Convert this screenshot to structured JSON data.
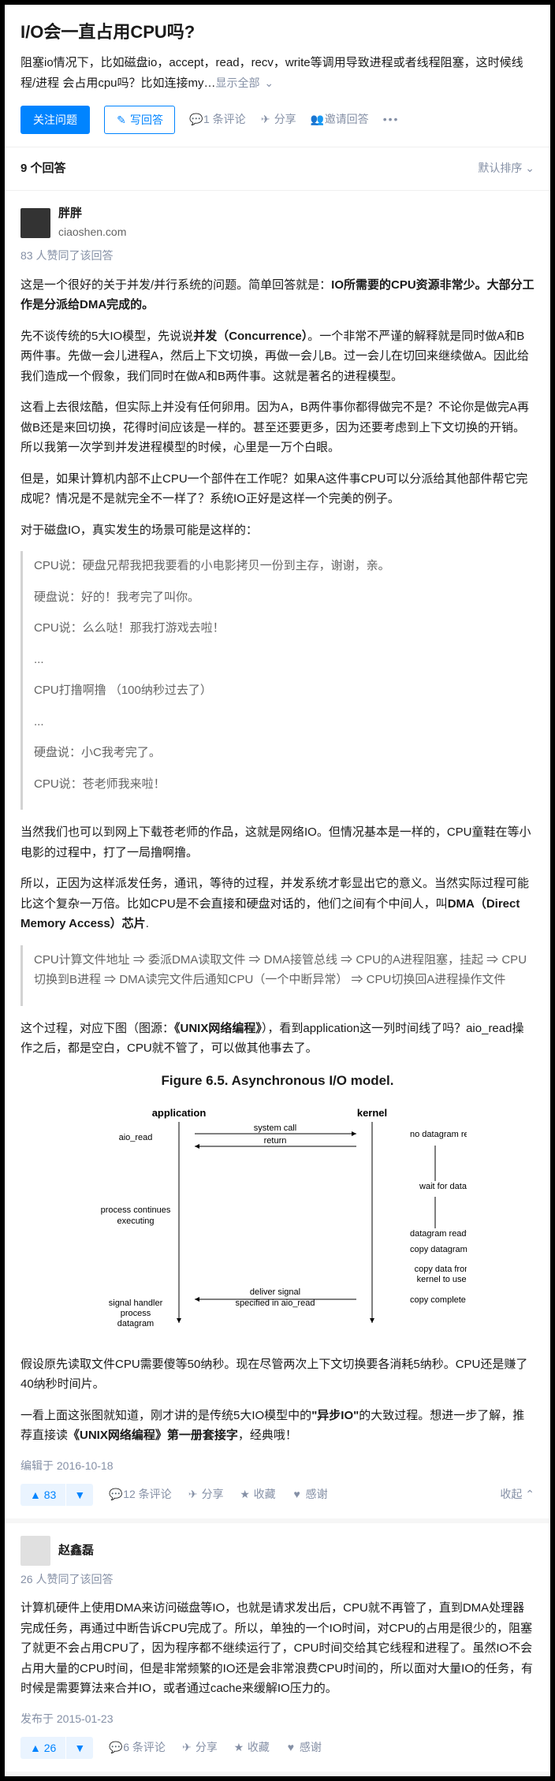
{
  "question": {
    "title": "I/O会一直占用CPU吗?",
    "body": "阻塞io情况下，比如磁盘io，accept，read，recv，write等调用导致进程或者线程阻塞，这时候线程/进程 会占用cpu吗？比如连接my…",
    "show_all": "显示全部",
    "follow": "关注问题",
    "write": "写回答",
    "comments": "1 条评论",
    "share": "分享",
    "invite": "邀请回答"
  },
  "answers_header": {
    "count": "9 个回答",
    "sort": "默认排序"
  },
  "answer1": {
    "author": {
      "name": "胖胖",
      "bio": "ciaoshen.com"
    },
    "upvotes_line": "83 人赞同了该回答",
    "p1a": "这是一个很好的关于并发/并行系统的问题。简单回答就是：",
    "p1b": "IO所需要的CPU资源非常少。大部分工作是分派给DMA完成的。",
    "p2a": "先不谈传统的5大IO模型，先说说",
    "p2b": "并发（Concurrence）",
    "p2c": "。一个非常不严谨的解释就是同时做A和B两件事。先做一会儿进程A，然后上下文切换，再做一会儿B。过一会儿在切回来继续做A。因此给我们造成一个假象，我们同时在做A和B两件事。这就是著名的进程模型。",
    "p3": "这看上去很炫酷，但实际上并没有任何卵用。因为A，B两件事你都得做完不是？不论你是做完A再做B还是来回切换，花得时间应该是一样的。甚至还要更多，因为还要考虑到上下文切换的开销。所以我第一次学到并发进程模型的时候，心里是一万个白眼。",
    "p4": "但是，如果计算机内部不止CPU一个部件在工作呢？如果A这件事CPU可以分派给其他部件帮它完成呢？情况是不是就完全不一样了？系统IO正好是这样一个完美的例子。",
    "p5": "对于磁盘IO，真实发生的场景可能是这样的：",
    "quote1": {
      "l1": "CPU说：硬盘兄帮我把我要看的小电影拷贝一份到主存，谢谢，亲。",
      "l2": "硬盘说：好的！我考完了叫你。",
      "l3": "CPU说：么么哒！那我打游戏去啦！",
      "l4": "...",
      "l5": "CPU打撸啊撸 （100纳秒过去了）",
      "l6": "...",
      "l7": "硬盘说：小C我考完了。",
      "l8": "CPU说：苍老师我来啦！"
    },
    "p6": "当然我们也可以到网上下载苍老师的作品，这就是网络IO。但情况基本是一样的，CPU童鞋在等小电影的过程中，打了一局撸啊撸。",
    "p7a": "所以，正因为这样派发任务，通讯，等待的过程，并发系统才彰显出它的意义。当然实际过程可能比这个复杂一万倍。比如CPU是不会直接和硬盘对话的，他们之间有个中间人，叫",
    "p7b": "DMA（Direct Memory Access）芯片",
    "quote2": "CPU计算文件地址 ⇒ 委派DMA读取文件 ⇒ DMA接管总线 ⇒ CPU的A进程阻塞，挂起 ⇒ CPU切换到B进程 ⇒ DMA读完文件后通知CPU（一个中断异常） ⇒ CPU切换回A进程操作文件",
    "p8a": "这个过程，对应下图（图源：",
    "p8b": "《UNIX网络编程》",
    "p8c": "），看到application这一列时间线了吗？aio_read操作之后，都是空白，CPU就不管了，可以做其他事去了。",
    "figure_title": "Figure 6.5. Asynchronous I/O model.",
    "p9": "假设原先读取文件CPU需要傻等50纳秒。现在尽管两次上下文切换要各消耗5纳秒。CPU还是赚了40纳秒时间片。",
    "p10a": "一看上面这张图就知道，刚才讲的是传统5大IO模型中的",
    "p10b": "\"异步IO\"",
    "p10c": "的大致过程。想进一步了解，推荐直接读",
    "p10d": "《UNIX网络编程》第一册套接字",
    "p10e": "，经典哦！",
    "edited": "编辑于 2016-10-18",
    "actions": {
      "up": "▲ 83",
      "down": "▼",
      "comments": "12 条评论",
      "share": "分享",
      "fav": "收藏",
      "thank": "感谢",
      "collapse": "收起"
    }
  },
  "answer2": {
    "author": {
      "name": "赵鑫磊"
    },
    "upvotes_line": "26 人赞同了该回答",
    "p1": "计算机硬件上使用DMA来访问磁盘等IO，也就是请求发出后，CPU就不再管了，直到DMA处理器完成任务，再通过中断告诉CPU完成了。所以，单独的一个IO时间，对CPU的占用是很少的，阻塞了就更不会占用CPU了，因为程序都不继续运行了，CPU时间交给其它线程和进程了。虽然IO不会占用大量的CPU时间，但是非常频繁的IO还是会非常浪费CPU时间的，所以面对大量IO的任务，有时候是需要算法来合并IO，或者通过cache来缓解IO压力的。",
    "posted": "发布于 2015-01-23",
    "actions": {
      "up": "▲ 26",
      "down": "▼",
      "comments": "6 条评论",
      "share": "分享",
      "fav": "收藏",
      "thank": "感谢"
    }
  },
  "chart_data": {
    "type": "diagram",
    "title": "Figure 6.5. Asynchronous I/O model.",
    "columns": [
      "application",
      "kernel"
    ],
    "events": [
      {
        "from": "application",
        "to": "kernel",
        "label": "system call",
        "sub": "aio_read / return"
      },
      {
        "at": "kernel",
        "label": "no datagram ready"
      },
      {
        "at": "kernel",
        "label": "wait for data",
        "phase": true
      },
      {
        "at": "application",
        "label": "process continues executing"
      },
      {
        "at": "kernel",
        "label": "datagram ready"
      },
      {
        "at": "kernel",
        "label": "copy datagram"
      },
      {
        "at": "kernel",
        "label": "copy data from kernel to user",
        "phase": true
      },
      {
        "from": "kernel",
        "to": "application",
        "label": "deliver signal specified in aio_read"
      },
      {
        "at": "kernel",
        "label": "copy complete"
      },
      {
        "at": "application",
        "label": "signal handler process datagram"
      }
    ]
  }
}
